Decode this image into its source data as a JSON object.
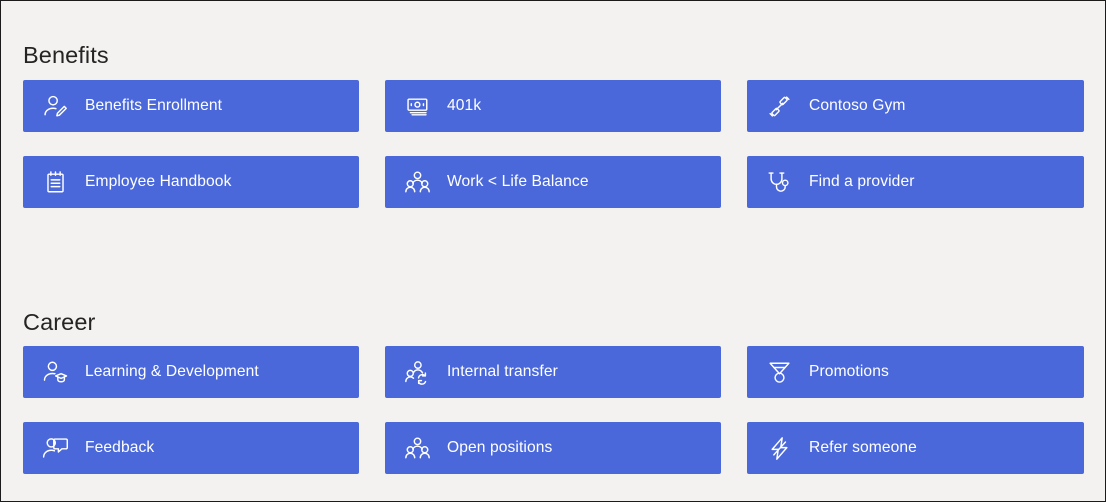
{
  "theme": {
    "page_background": "#f3f2f1",
    "tile_background": "#4a68d9",
    "tile_text": "#ffffff",
    "heading_text": "#252423",
    "border": "#1b1b1b"
  },
  "sections": [
    {
      "id": "benefits",
      "heading": "Benefits",
      "tiles": [
        {
          "label": "Benefits Enrollment",
          "icon": "person-edit-icon"
        },
        {
          "label": "401k",
          "icon": "money-bill-icon"
        },
        {
          "label": "Contoso Gym",
          "icon": "dumbbell-icon"
        },
        {
          "label": "Employee Handbook",
          "icon": "notepad-icon"
        },
        {
          "label": "Work < Life Balance",
          "icon": "people-group-icon"
        },
        {
          "label": "Find a provider",
          "icon": "stethoscope-icon"
        }
      ]
    },
    {
      "id": "career",
      "heading": "Career",
      "tiles": [
        {
          "label": "Learning & Development",
          "icon": "person-graduation-icon"
        },
        {
          "label": "Internal transfer",
          "icon": "people-sync-icon"
        },
        {
          "label": "Promotions",
          "icon": "medal-icon"
        },
        {
          "label": "Feedback",
          "icon": "person-feedback-icon"
        },
        {
          "label": "Open positions",
          "icon": "people-group-icon"
        },
        {
          "label": "Refer someone",
          "icon": "lightning-bolt-icon"
        }
      ]
    }
  ]
}
